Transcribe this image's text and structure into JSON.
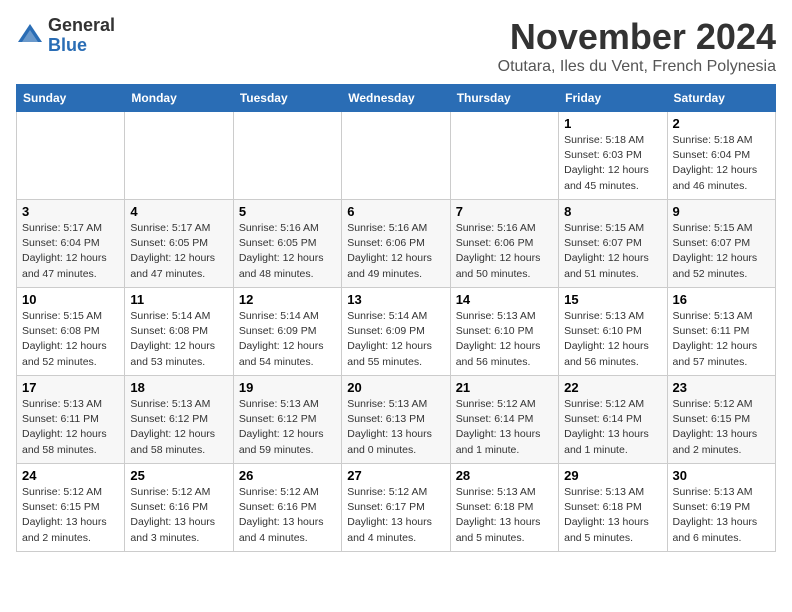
{
  "header": {
    "logo_general": "General",
    "logo_blue": "Blue",
    "title": "November 2024",
    "subtitle": "Otutara, Iles du Vent, French Polynesia"
  },
  "days_of_week": [
    "Sunday",
    "Monday",
    "Tuesday",
    "Wednesday",
    "Thursday",
    "Friday",
    "Saturday"
  ],
  "weeks": [
    [
      {
        "day": "",
        "info": ""
      },
      {
        "day": "",
        "info": ""
      },
      {
        "day": "",
        "info": ""
      },
      {
        "day": "",
        "info": ""
      },
      {
        "day": "",
        "info": ""
      },
      {
        "day": "1",
        "info": "Sunrise: 5:18 AM\nSunset: 6:03 PM\nDaylight: 12 hours\nand 45 minutes."
      },
      {
        "day": "2",
        "info": "Sunrise: 5:18 AM\nSunset: 6:04 PM\nDaylight: 12 hours\nand 46 minutes."
      }
    ],
    [
      {
        "day": "3",
        "info": "Sunrise: 5:17 AM\nSunset: 6:04 PM\nDaylight: 12 hours\nand 47 minutes."
      },
      {
        "day": "4",
        "info": "Sunrise: 5:17 AM\nSunset: 6:05 PM\nDaylight: 12 hours\nand 47 minutes."
      },
      {
        "day": "5",
        "info": "Sunrise: 5:16 AM\nSunset: 6:05 PM\nDaylight: 12 hours\nand 48 minutes."
      },
      {
        "day": "6",
        "info": "Sunrise: 5:16 AM\nSunset: 6:06 PM\nDaylight: 12 hours\nand 49 minutes."
      },
      {
        "day": "7",
        "info": "Sunrise: 5:16 AM\nSunset: 6:06 PM\nDaylight: 12 hours\nand 50 minutes."
      },
      {
        "day": "8",
        "info": "Sunrise: 5:15 AM\nSunset: 6:07 PM\nDaylight: 12 hours\nand 51 minutes."
      },
      {
        "day": "9",
        "info": "Sunrise: 5:15 AM\nSunset: 6:07 PM\nDaylight: 12 hours\nand 52 minutes."
      }
    ],
    [
      {
        "day": "10",
        "info": "Sunrise: 5:15 AM\nSunset: 6:08 PM\nDaylight: 12 hours\nand 52 minutes."
      },
      {
        "day": "11",
        "info": "Sunrise: 5:14 AM\nSunset: 6:08 PM\nDaylight: 12 hours\nand 53 minutes."
      },
      {
        "day": "12",
        "info": "Sunrise: 5:14 AM\nSunset: 6:09 PM\nDaylight: 12 hours\nand 54 minutes."
      },
      {
        "day": "13",
        "info": "Sunrise: 5:14 AM\nSunset: 6:09 PM\nDaylight: 12 hours\nand 55 minutes."
      },
      {
        "day": "14",
        "info": "Sunrise: 5:13 AM\nSunset: 6:10 PM\nDaylight: 12 hours\nand 56 minutes."
      },
      {
        "day": "15",
        "info": "Sunrise: 5:13 AM\nSunset: 6:10 PM\nDaylight: 12 hours\nand 56 minutes."
      },
      {
        "day": "16",
        "info": "Sunrise: 5:13 AM\nSunset: 6:11 PM\nDaylight: 12 hours\nand 57 minutes."
      }
    ],
    [
      {
        "day": "17",
        "info": "Sunrise: 5:13 AM\nSunset: 6:11 PM\nDaylight: 12 hours\nand 58 minutes."
      },
      {
        "day": "18",
        "info": "Sunrise: 5:13 AM\nSunset: 6:12 PM\nDaylight: 12 hours\nand 58 minutes."
      },
      {
        "day": "19",
        "info": "Sunrise: 5:13 AM\nSunset: 6:12 PM\nDaylight: 12 hours\nand 59 minutes."
      },
      {
        "day": "20",
        "info": "Sunrise: 5:13 AM\nSunset: 6:13 PM\nDaylight: 13 hours\nand 0 minutes."
      },
      {
        "day": "21",
        "info": "Sunrise: 5:12 AM\nSunset: 6:14 PM\nDaylight: 13 hours\nand 1 minute."
      },
      {
        "day": "22",
        "info": "Sunrise: 5:12 AM\nSunset: 6:14 PM\nDaylight: 13 hours\nand 1 minute."
      },
      {
        "day": "23",
        "info": "Sunrise: 5:12 AM\nSunset: 6:15 PM\nDaylight: 13 hours\nand 2 minutes."
      }
    ],
    [
      {
        "day": "24",
        "info": "Sunrise: 5:12 AM\nSunset: 6:15 PM\nDaylight: 13 hours\nand 2 minutes."
      },
      {
        "day": "25",
        "info": "Sunrise: 5:12 AM\nSunset: 6:16 PM\nDaylight: 13 hours\nand 3 minutes."
      },
      {
        "day": "26",
        "info": "Sunrise: 5:12 AM\nSunset: 6:16 PM\nDaylight: 13 hours\nand 4 minutes."
      },
      {
        "day": "27",
        "info": "Sunrise: 5:12 AM\nSunset: 6:17 PM\nDaylight: 13 hours\nand 4 minutes."
      },
      {
        "day": "28",
        "info": "Sunrise: 5:13 AM\nSunset: 6:18 PM\nDaylight: 13 hours\nand 5 minutes."
      },
      {
        "day": "29",
        "info": "Sunrise: 5:13 AM\nSunset: 6:18 PM\nDaylight: 13 hours\nand 5 minutes."
      },
      {
        "day": "30",
        "info": "Sunrise: 5:13 AM\nSunset: 6:19 PM\nDaylight: 13 hours\nand 6 minutes."
      }
    ]
  ]
}
